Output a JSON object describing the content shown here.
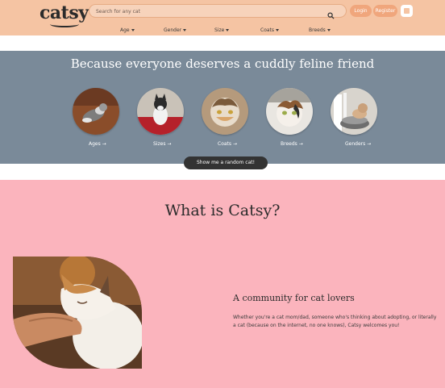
{
  "header": {
    "logo": "catsy",
    "search_placeholder": "Search for any cat",
    "login_label": "Login",
    "register_label": "Register",
    "icons": {
      "search": "search-icon",
      "cart": "cart-icon"
    },
    "background_color": "#f5c4a3"
  },
  "nav": {
    "items": [
      {
        "label": "Age"
      },
      {
        "label": "Gender"
      },
      {
        "label": "Size"
      },
      {
        "label": "Coats"
      },
      {
        "label": "Breeds"
      }
    ]
  },
  "hero": {
    "title": "Because everyone deserves a cuddly feline friend",
    "background_color": "#7a8a99",
    "categories": [
      {
        "label": "Ages"
      },
      {
        "label": "Sizes"
      },
      {
        "label": "Coats"
      },
      {
        "label": "Breeds"
      },
      {
        "label": "Genders"
      }
    ],
    "random_button": "Show me a random cat!"
  },
  "about": {
    "background_color": "#fbb4bd",
    "title": "What is Catsy?",
    "subheading": "A community for cat lovers",
    "description": "Whether you're a cat mom/dad, someone who's thinking about adopting, or literally a cat (because on the internet, no one knows), Catsy welcomes you!"
  }
}
